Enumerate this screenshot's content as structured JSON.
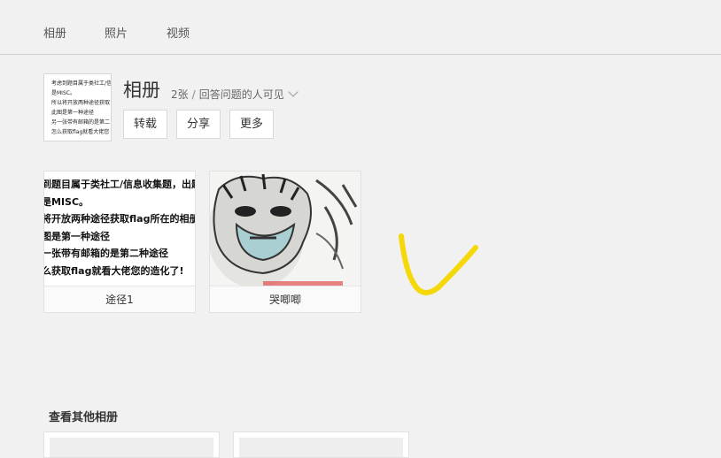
{
  "nav": {
    "tabs": [
      {
        "label": "相册"
      },
      {
        "label": "照片"
      },
      {
        "label": "视频"
      }
    ]
  },
  "album": {
    "title": "相册",
    "count": "2张",
    "separator": "/",
    "visibility": "回答问题的人可见",
    "cover_text": [
      "考虑到题目属于类社工/信",
      "是MISC。",
      "所以将开放两种途径获取",
      "此图是第一种途径",
      "另一张带有邮箱的是第二",
      "怎么获取flag就看大佬您"
    ]
  },
  "actions": {
    "repost": "转载",
    "share": "分享",
    "more": "更多"
  },
  "photos": [
    {
      "caption": "途径1",
      "text_lines": [
        "到题目属于类社工/信息收集题，出题",
        "是MISC。",
        "将开放两种途径获取flag所在的相册",
        "图是第一种途径",
        "一张带有邮箱的是第二种途径",
        "么获取flag就看大佬您的造化了!"
      ]
    },
    {
      "caption": "哭唧唧"
    }
  ],
  "other_albums": {
    "title": "查看其他相册"
  },
  "colors": {
    "annotation": "#f5d80a"
  }
}
